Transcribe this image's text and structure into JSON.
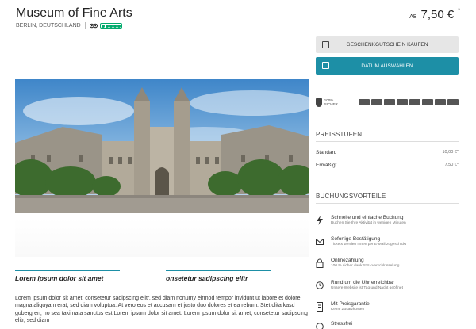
{
  "header": {
    "title": "Museum of Fine Arts",
    "location": "BERLIN, DEUTSCHLAND",
    "price_prefix": "AB",
    "price": "7,50 €",
    "price_superscript": "*"
  },
  "actions": {
    "gift_label": "GESCHENKGUTSCHEIN KAUFEN",
    "date_label": "DATUM AUSWÄHLEN"
  },
  "payment": {
    "secure_label": "100% SICHER",
    "methods": [
      "credit-card-icon",
      "sepa-icon",
      "visa-icon",
      "mastercard-icon",
      "amex-icon",
      "diners-icon",
      "sofort-icon",
      "paypal-icon"
    ]
  },
  "prices": {
    "heading": "PREISSTUFEN",
    "rows": [
      {
        "label": "Standard",
        "value": "10,00 €*"
      },
      {
        "label": "Ermäßigt",
        "value": "7,50 €*"
      }
    ]
  },
  "benefits": {
    "heading": "BUCHUNGSVORTEILE",
    "items": [
      {
        "title": "Schnelle und einfache Buchung",
        "subtitle": "Buchen Sie Ihre Aktivität in wenigen Minuten"
      },
      {
        "title": "Sofortige Bestätigung",
        "subtitle": "Tickets werden Ihnen per E-Mail zugeschickt"
      },
      {
        "title": "Onlinezahlung",
        "subtitle": "100 % sicher dank SSL-Verschlüsselung"
      },
      {
        "title": "Rund um die Uhr erreichbar",
        "subtitle": "Unsere Website ist Tag und Nacht geöffnet"
      },
      {
        "title": "Mit Preisgarantie",
        "subtitle": "Keine Zusatzkosten"
      },
      {
        "title": "Stressfrei",
        "subtitle": ""
      }
    ]
  },
  "content": {
    "col1": "Lorem ipsum dolor sit amet",
    "col2": "onsetetur sadipscing elitr",
    "paragraph": "Lorem ipsum dolor sit amet, consetetur sadipscing elitr, sed diam nonumy eirmod tempor invidunt ut labore et dolore magna aliquyam erat, sed diam voluptua. At vero eos et accusam et justo duo dolores et ea rebum. Stet clita kasd gubergren, no sea takimata sanctus est Lorem ipsum dolor sit amet. Lorem ipsum dolor sit amet, consetetur sadipscing elitr, sed diam"
  },
  "colors": {
    "accent": "#1d8fa6",
    "gift_button_bg": "#e6e6e6",
    "tripadvisor": "#00aa6c"
  }
}
